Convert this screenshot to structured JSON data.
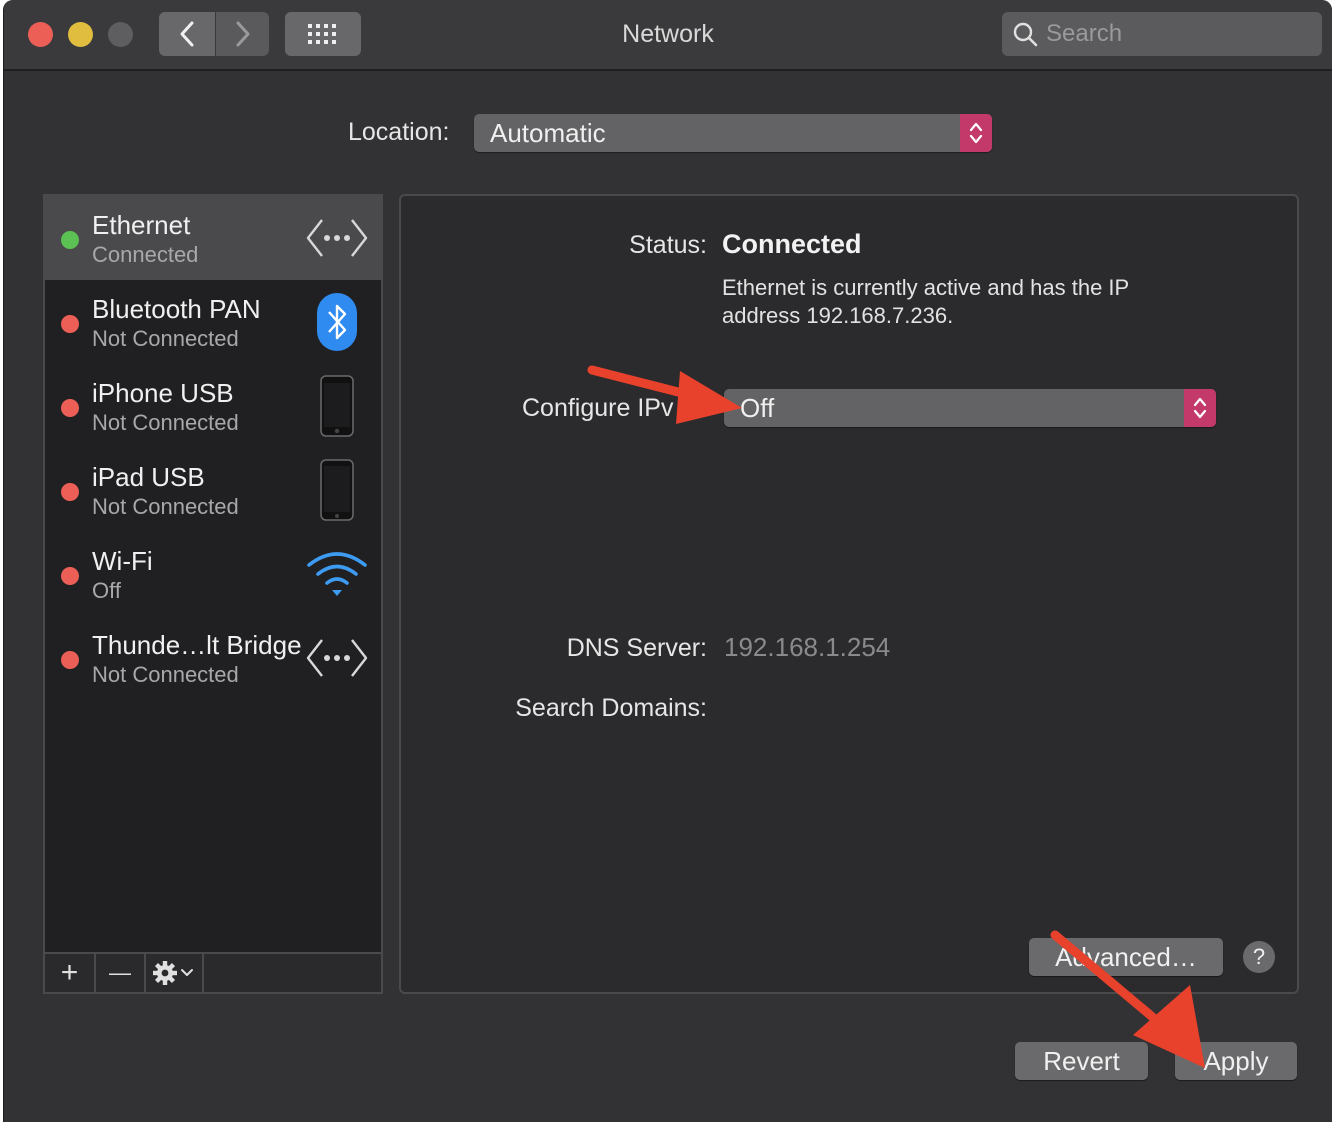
{
  "window": {
    "title": "Network",
    "search_placeholder": "Search"
  },
  "location": {
    "label": "Location:",
    "value": "Automatic"
  },
  "services": [
    {
      "name": "Ethernet",
      "state": "Connected",
      "status_color": "#5ac152",
      "icon": "ethernet-icon",
      "selected": true
    },
    {
      "name": "Bluetooth PAN",
      "state": "Not Connected",
      "status_color": "#ec5f57",
      "icon": "bluetooth-icon"
    },
    {
      "name": "iPhone USB",
      "state": "Not Connected",
      "status_color": "#ec5f57",
      "icon": "iphone-icon"
    },
    {
      "name": "iPad USB",
      "state": "Not Connected",
      "status_color": "#ec5f57",
      "icon": "ipad-icon"
    },
    {
      "name": "Wi-Fi",
      "state": "Off",
      "status_color": "#ec5f57",
      "icon": "wifi-icon"
    },
    {
      "name": "Thunde…lt Bridge",
      "state": "Not Connected",
      "status_color": "#ec5f57",
      "icon": "ethernet-icon"
    }
  ],
  "sidebar_tools": {
    "add": "+",
    "remove": "—"
  },
  "detail": {
    "status_label": "Status:",
    "status_value": "Connected",
    "status_description": "Ethernet is currently active and has the IP address 192.168.7.236.",
    "configure_label": "Configure IPv",
    "configure_value": "Off",
    "dns_label": "DNS Server:",
    "dns_value": "192.168.1.254",
    "search_domains_label": "Search Domains:",
    "advanced_label": "Advanced…",
    "help_label": "?"
  },
  "footer": {
    "revert_label": "Revert",
    "apply_label": "Apply"
  },
  "colors": {
    "accent_stepper": "#c33a6a",
    "annotation_arrow": "#e8412c",
    "wifi_blue": "#3d9bf2",
    "bluetooth_blue": "#2f8bf0"
  }
}
